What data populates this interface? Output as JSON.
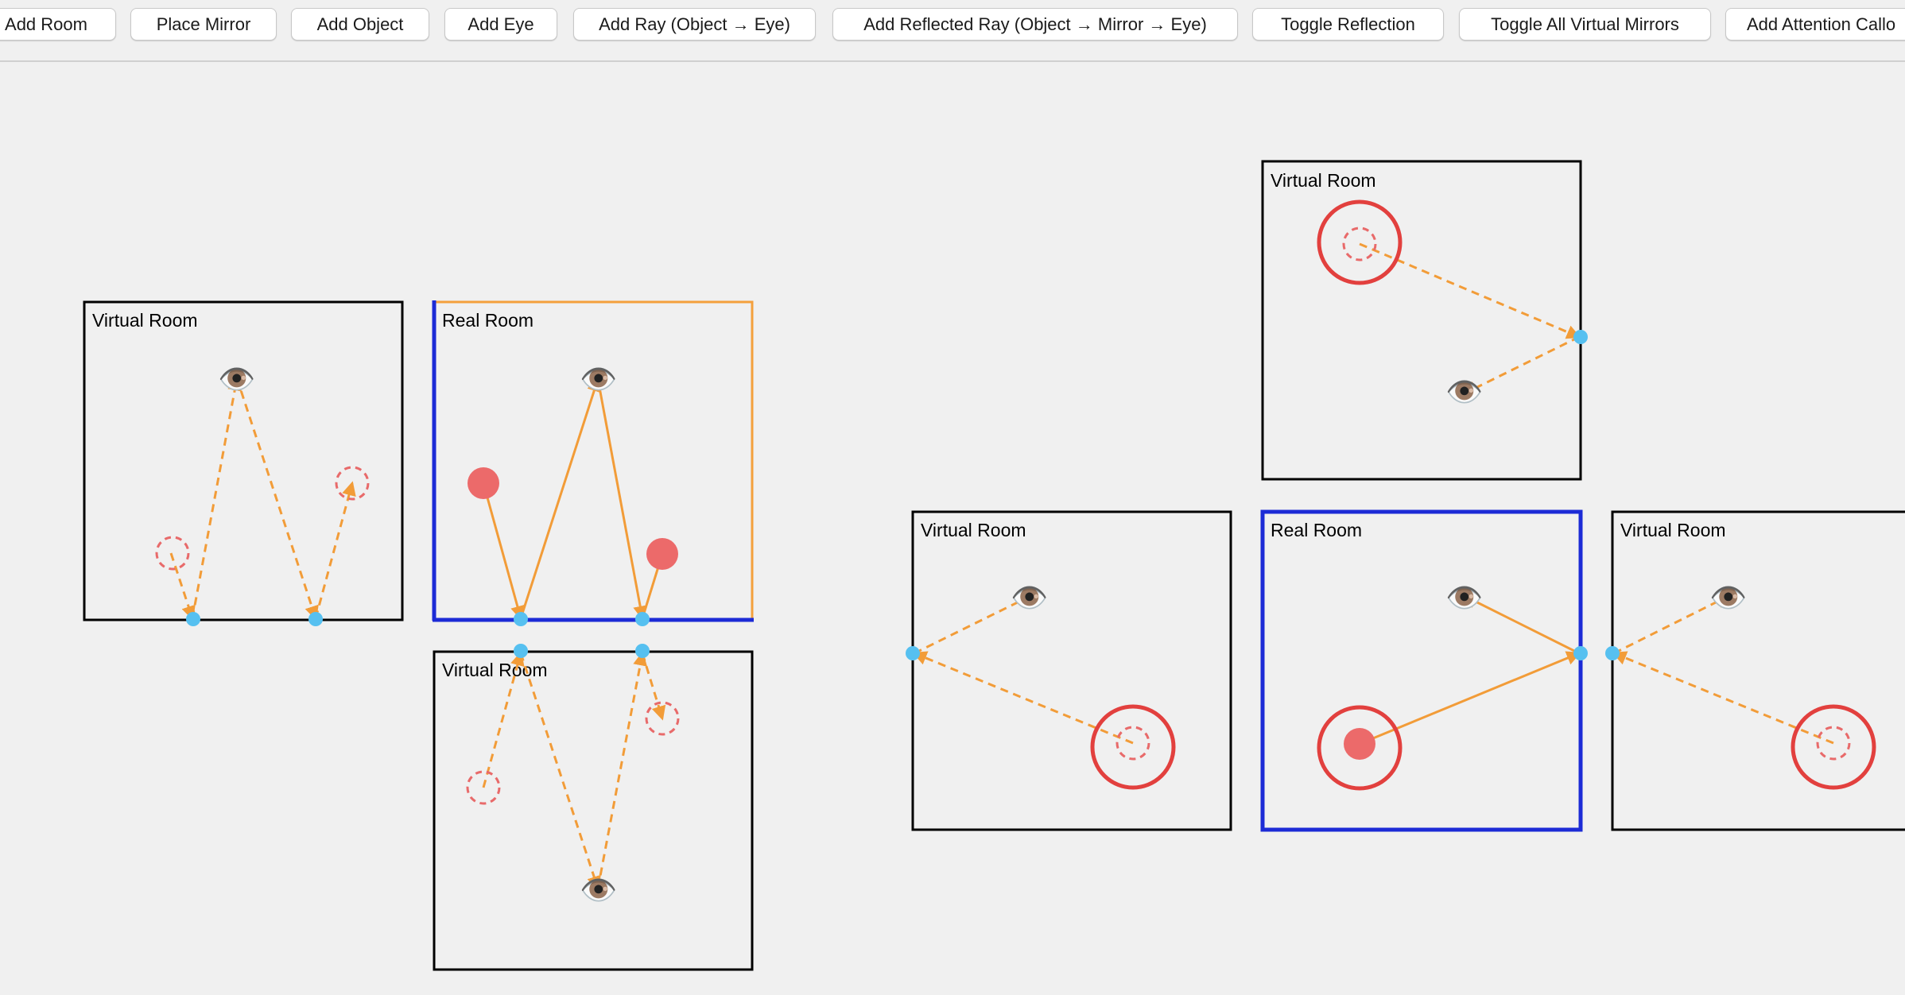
{
  "toolbar": {
    "buttons": [
      {
        "id": "add-room",
        "label": "Add Room"
      },
      {
        "id": "place-mirror",
        "label": "Place Mirror"
      },
      {
        "id": "add-object",
        "label": "Add Object"
      },
      {
        "id": "add-eye",
        "label": "Add Eye"
      },
      {
        "id": "add-ray",
        "label": "Add Ray (Object → Eye)"
      },
      {
        "id": "add-reflected-ray",
        "label": "Add Reflected Ray (Object → Mirror → Eye)"
      },
      {
        "id": "toggle-reflection",
        "label": "Toggle Reflection"
      },
      {
        "id": "toggle-all-virtual-mirrors",
        "label": "Toggle All Virtual Mirrors"
      },
      {
        "id": "add-attention-callout",
        "label": "Add Attention Callo"
      }
    ]
  },
  "labels": {
    "real_room": "Real Room",
    "virtual_room": "Virtual Room"
  },
  "colors": {
    "room_border": "#000000",
    "mirror": "#1c2bd6",
    "selected_room": "#f4a03c",
    "ray": "#f29c38",
    "object": "#ec6a6a",
    "virtual_object": "#e86a6a",
    "attention_circle": "#e2403e",
    "reflection_point": "#56c0f0",
    "background": "#f0f0f0"
  },
  "icons": {
    "eye": "eye-icon",
    "object": "object-dot",
    "virtual_object": "virtual-object-dashed-circle",
    "reflection_point": "reflection-point-dot"
  },
  "eye_glyph": "👁️"
}
